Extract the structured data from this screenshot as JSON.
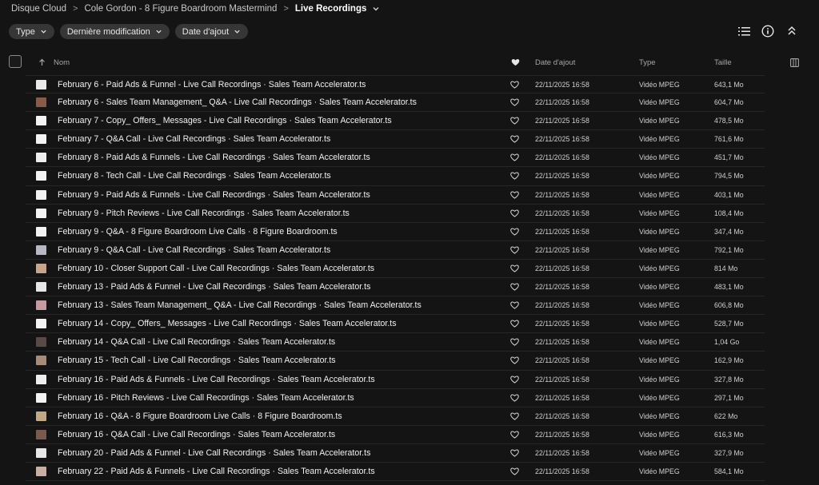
{
  "breadcrumb": {
    "items": [
      "Disque Cloud",
      "Cole Gordon - 8 Figure Boardroom Mastermind",
      "Live Recordings"
    ],
    "separator": ">"
  },
  "filters": [
    "Type",
    "Dernière modification",
    "Date d'ajout"
  ],
  "toolbar_icons": [
    "list-view-icon",
    "info-icon",
    "collapse-icon"
  ],
  "columns": {
    "name": "Nom",
    "date_added": "Date d'ajout",
    "type": "Type",
    "size": "Taille"
  },
  "files": [
    {
      "name": "February 6 - Paid Ads & Funnel - Live Call Recordings · Sales Team Accelerator.ts",
      "date": "22/11/2025 16:58",
      "type": "Vidéo MPEG",
      "size": "643,1 Mo",
      "thumb": "#e9e9e9"
    },
    {
      "name": "February 6 - Sales Team Management_ Q&A - Live Call Recordings · Sales Team Accelerator.ts",
      "date": "22/11/2025 16:58",
      "type": "Vidéo MPEG",
      "size": "604,7 Mo",
      "thumb": "#8a5a48"
    },
    {
      "name": "February 7 - Copy_ Offers_ Messages - Live Call Recordings · Sales Team Accelerator.ts",
      "date": "22/11/2025 16:58",
      "type": "Vidéo MPEG",
      "size": "478,5 Mo",
      "thumb": "#f3f3f3"
    },
    {
      "name": "February 7 - Q&A Call - Live Call Recordings · Sales Team Accelerator.ts",
      "date": "22/11/2025 16:58",
      "type": "Vidéo MPEG",
      "size": "761,6 Mo",
      "thumb": "#f3f3f3"
    },
    {
      "name": "February 8 - Paid Ads & Funnels - Live Call Recordings · Sales Team Accelerator.ts",
      "date": "22/11/2025 16:58",
      "type": "Vidéo MPEG",
      "size": "451,7 Mo",
      "thumb": "#eeeeee"
    },
    {
      "name": "February 8 - Tech Call - Live Call Recordings · Sales Team Accelerator.ts",
      "date": "22/11/2025 16:58",
      "type": "Vidéo MPEG",
      "size": "794,5 Mo",
      "thumb": "#f3f3f3"
    },
    {
      "name": "February 9 - Paid Ads & Funnels - Live Call Recordings · Sales Team Accelerator.ts",
      "date": "22/11/2025 16:58",
      "type": "Vidéo MPEG",
      "size": "403,1 Mo",
      "thumb": "#f3f3f3"
    },
    {
      "name": "February 9 - Pitch Reviews - Live Call Recordings · Sales Team Accelerator.ts",
      "date": "22/11/2025 16:58",
      "type": "Vidéo MPEG",
      "size": "108,4 Mo",
      "thumb": "#f3f3f3"
    },
    {
      "name": "February 9 - Q&A - 8 Figure Boardroom Live Calls · 8 Figure Boardroom.ts",
      "date": "22/11/2025 16:58",
      "type": "Vidéo MPEG",
      "size": "347,4 Mo",
      "thumb": "#f3f3f3"
    },
    {
      "name": "February 9 - Q&A Call - Live Call Recordings · Sales Team Accelerator.ts",
      "date": "22/11/2025 16:58",
      "type": "Vidéo MPEG",
      "size": "792,1 Mo",
      "thumb": "#b8b8c4"
    },
    {
      "name": "February 10 - Closer Support Call - Live Call Recordings · Sales Team Accelerator.ts",
      "date": "22/11/2025 16:58",
      "type": "Vidéo MPEG",
      "size": "814 Mo",
      "thumb": "#c9a48a"
    },
    {
      "name": "February 13 - Paid Ads & Funnel - Live Call Recordings · Sales Team Accelerator.ts",
      "date": "22/11/2025 16:58",
      "type": "Vidéo MPEG",
      "size": "483,1 Mo",
      "thumb": "#e6e6e6"
    },
    {
      "name": "February 13 - Sales Team Management_ Q&A - Live Call Recordings · Sales Team Accelerator.ts",
      "date": "22/11/2025 16:58",
      "type": "Vidéo MPEG",
      "size": "606,8 Mo",
      "thumb": "#c79aa0"
    },
    {
      "name": "February 14 - Copy_ Offers_ Messages - Live Call Recordings · Sales Team Accelerator.ts",
      "date": "22/11/2025 16:58",
      "type": "Vidéo MPEG",
      "size": "528,7 Mo",
      "thumb": "#f3f3f3"
    },
    {
      "name": "February 14 - Q&A Call - Live Call Recordings · Sales Team Accelerator.ts",
      "date": "22/11/2025 16:58",
      "type": "Vidéo MPEG",
      "size": "1,04 Go",
      "thumb": "#5a4a46"
    },
    {
      "name": "February 15 - Tech Call - Live Call Recordings · Sales Team Accelerator.ts",
      "date": "22/11/2025 16:58",
      "type": "Vidéo MPEG",
      "size": "162,9 Mo",
      "thumb": "#a88a78"
    },
    {
      "name": "February 16 - Paid Ads & Funnels - Live Call Recordings · Sales Team Accelerator.ts",
      "date": "22/11/2025 16:58",
      "type": "Vidéo MPEG",
      "size": "327,8 Mo",
      "thumb": "#eeeeee"
    },
    {
      "name": "February 16 - Pitch Reviews - Live Call Recordings · Sales Team Accelerator.ts",
      "date": "22/11/2025 16:58",
      "type": "Vidéo MPEG",
      "size": "297,1 Mo",
      "thumb": "#f3f3f3"
    },
    {
      "name": "February 16 - Q&A - 8 Figure Boardroom Live Calls · 8 Figure Boardroom.ts",
      "date": "22/11/2025 16:58",
      "type": "Vidéo MPEG",
      "size": "622 Mo",
      "thumb": "#c4a884"
    },
    {
      "name": "February 16 - Q&A Call - Live Call Recordings · Sales Team Accelerator.ts",
      "date": "22/11/2025 16:58",
      "type": "Vidéo MPEG",
      "size": "616,3 Mo",
      "thumb": "#7a5a50"
    },
    {
      "name": "February 20 - Paid Ads & Funnel - Live Call Recordings · Sales Team Accelerator.ts",
      "date": "22/11/2025 16:58",
      "type": "Vidéo MPEG",
      "size": "327,9 Mo",
      "thumb": "#e6e6e6"
    },
    {
      "name": "February 22 - Paid Ads & Funnels - Live Call Recordings · Sales Team Accelerator.ts",
      "date": "22/11/2025 16:58",
      "type": "Vidéo MPEG",
      "size": "584,1 Mo",
      "thumb": "#c8b0a0"
    }
  ],
  "colors": {
    "background": "#141414",
    "chip": "#363636",
    "row_divider": "#262626"
  }
}
